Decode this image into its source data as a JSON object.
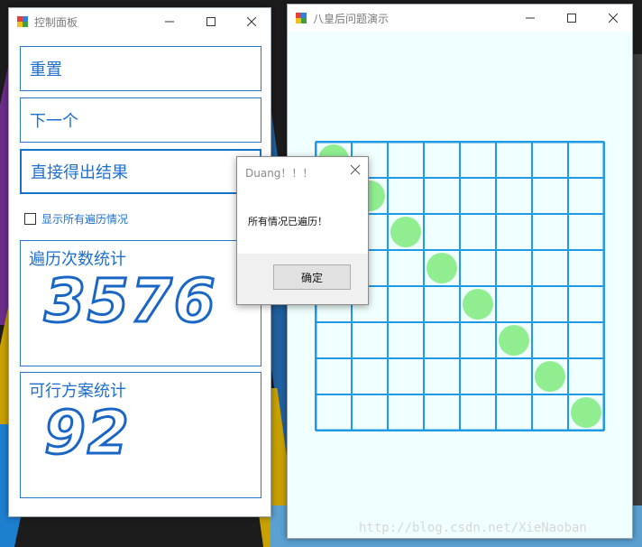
{
  "control_window": {
    "title": "控制面板",
    "buttons": {
      "reset": "重置",
      "next": "下一个",
      "solve": "直接得出结果"
    },
    "checkbox": {
      "label": "显示所有遍历情况",
      "checked": false
    },
    "traverse_stat": {
      "title": "遍历次数统计",
      "value": "3576"
    },
    "solution_stat": {
      "title": "可行方案统计",
      "value": "92"
    }
  },
  "board_window": {
    "title": "八皇后问题演示",
    "board_size": 8,
    "queens": [
      {
        "row": 1,
        "col": 1
      },
      {
        "row": 2,
        "col": 2
      },
      {
        "row": 3,
        "col": 3
      },
      {
        "row": 4,
        "col": 4
      },
      {
        "row": 5,
        "col": 5
      },
      {
        "row": 6,
        "col": 6
      },
      {
        "row": 7,
        "col": 7
      },
      {
        "row": 8,
        "col": 8
      }
    ],
    "colors": {
      "grid": "#1e9ae6",
      "queen": "#90ee90",
      "background": "#f0ffff"
    }
  },
  "dialog": {
    "title": "Duang！！！",
    "message": "所有情况已遍历！",
    "ok_label": "确定"
  },
  "watermark": "http://blog.csdn.net/XieNaoban",
  "colors": {
    "accent": "#1e6fd0",
    "border": "#2878c8"
  }
}
